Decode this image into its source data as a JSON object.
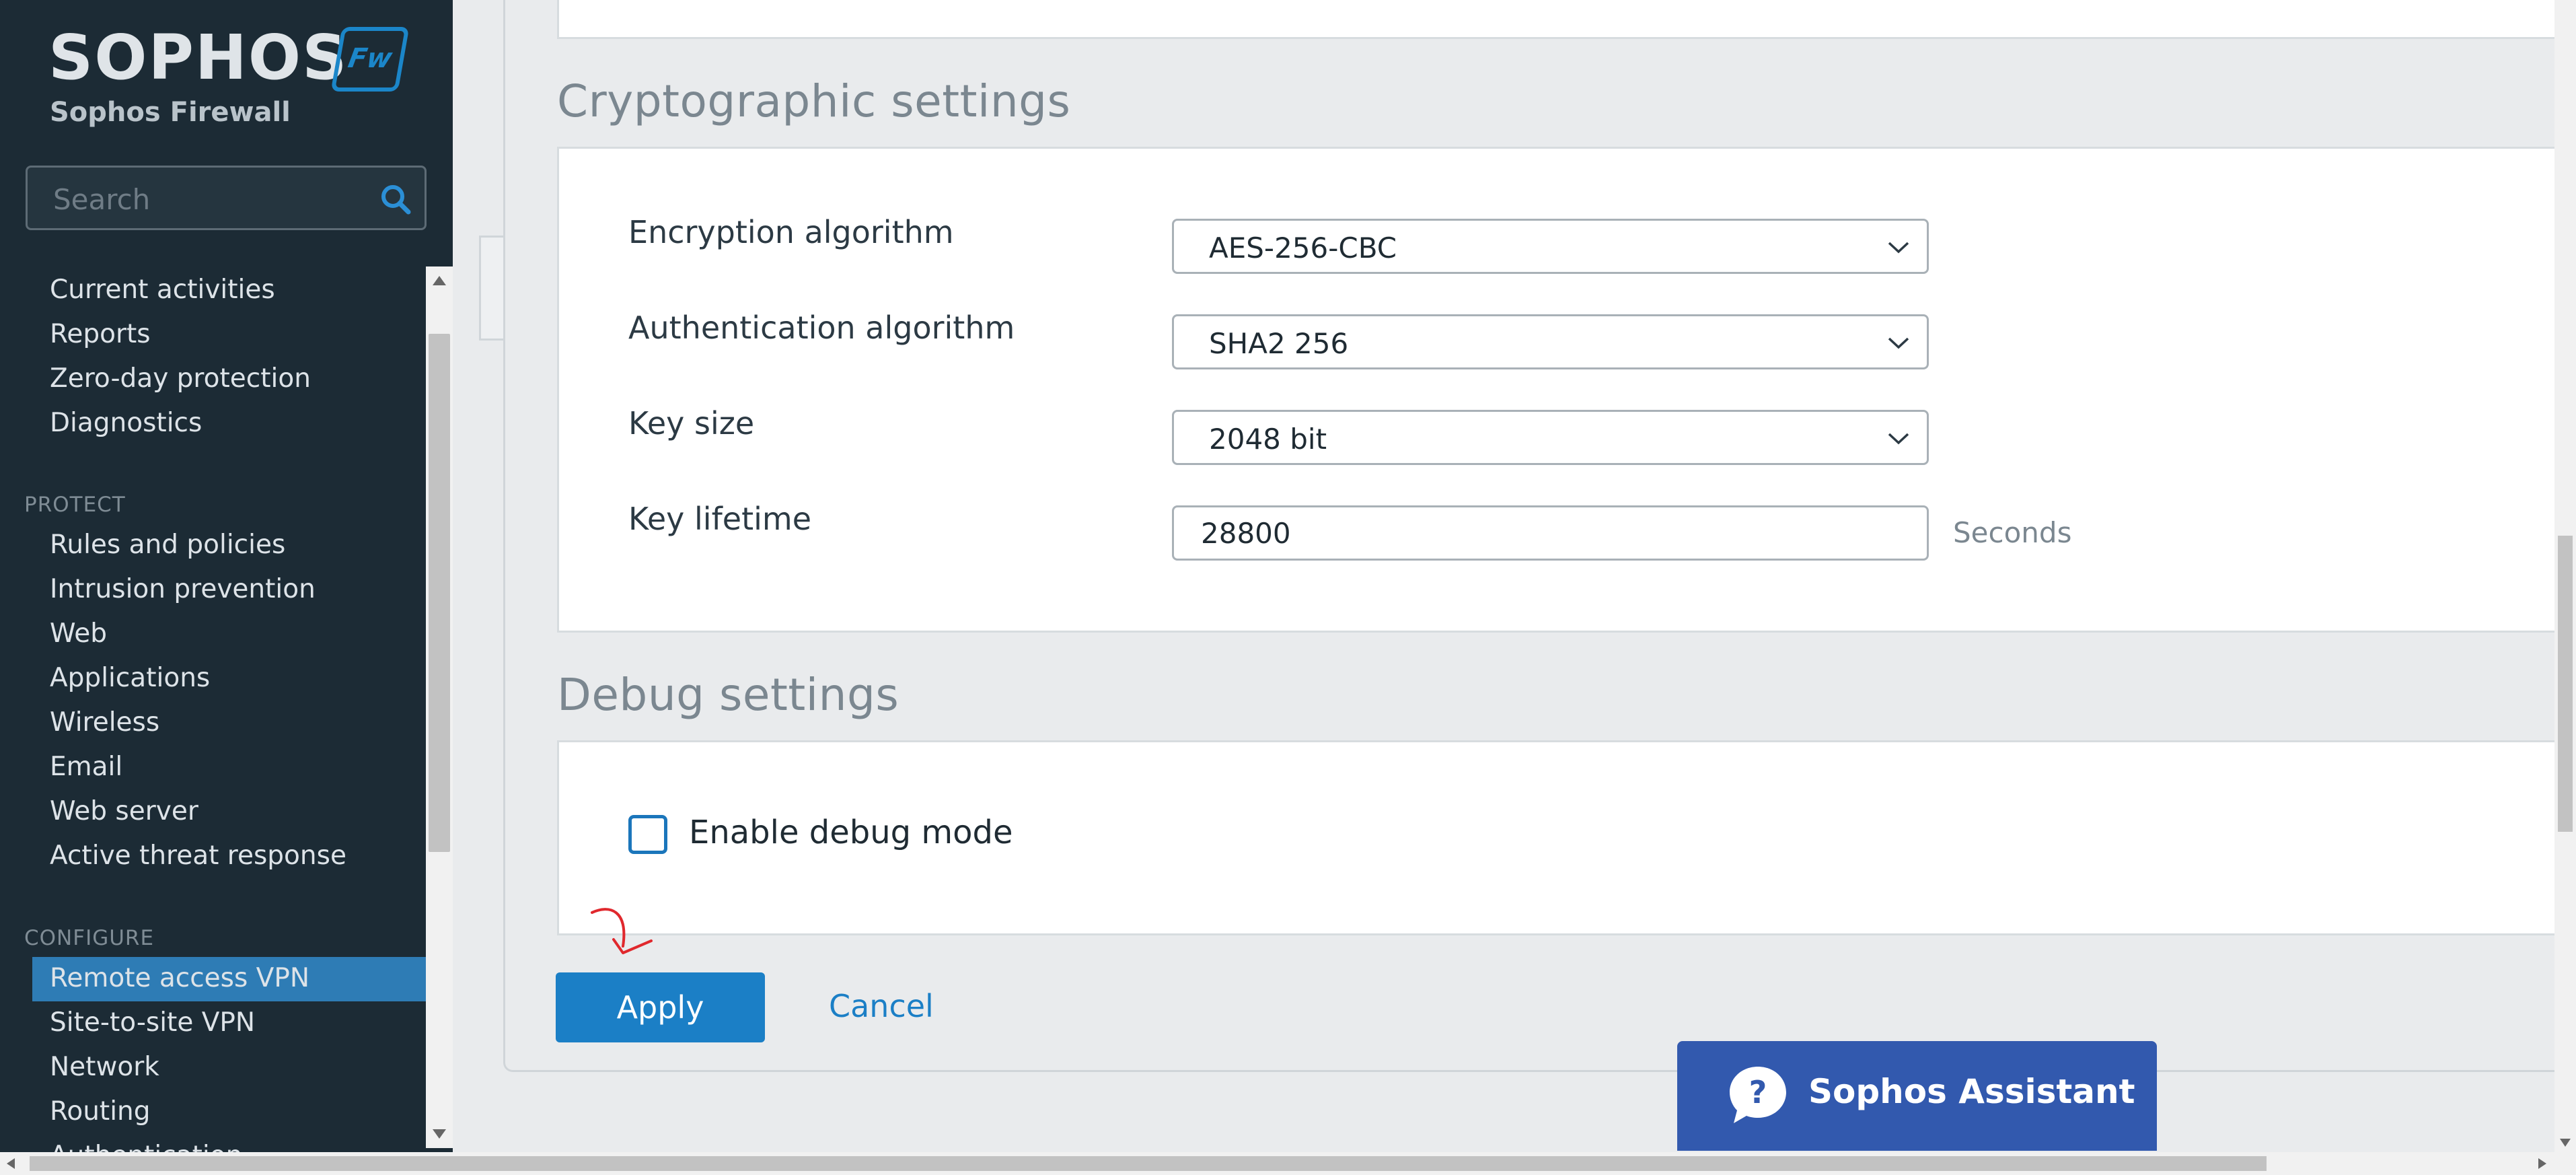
{
  "brand": {
    "logo_text": "SOPHOS",
    "badge_text": "Fw",
    "product_name": "Sophos Firewall"
  },
  "search": {
    "placeholder": "Search"
  },
  "nav": {
    "monitor_items": [
      "Current activities",
      "Reports",
      "Zero-day protection",
      "Diagnostics"
    ],
    "protect_header": "PROTECT",
    "protect_items": [
      "Rules and policies",
      "Intrusion prevention",
      "Web",
      "Applications",
      "Wireless",
      "Email",
      "Web server",
      "Active threat response"
    ],
    "configure_header": "CONFIGURE",
    "configure_items": [
      "Remote access VPN",
      "Site-to-site VPN",
      "Network",
      "Routing",
      "Authentication"
    ],
    "active_item": "Remote access VPN"
  },
  "crypto": {
    "title": "Cryptographic settings",
    "encryption_label": "Encryption algorithm",
    "encryption_value": "AES-256-CBC",
    "auth_label": "Authentication algorithm",
    "auth_value": "SHA2 256",
    "keysize_label": "Key size",
    "keysize_value": "2048 bit",
    "lifetime_label": "Key lifetime",
    "lifetime_value": "28800",
    "lifetime_unit": "Seconds"
  },
  "debug": {
    "title": "Debug settings",
    "checkbox_label": "Enable debug mode",
    "checked": false
  },
  "actions": {
    "apply_label": "Apply",
    "cancel_label": "Cancel"
  },
  "assistant": {
    "label": "Sophos Assistant"
  },
  "colors": {
    "sidebar_bg": "#1c2b35",
    "active_item_bg": "#2e7cb5",
    "primary": "#1b7fc6",
    "assistant_bg": "#3259ae"
  }
}
